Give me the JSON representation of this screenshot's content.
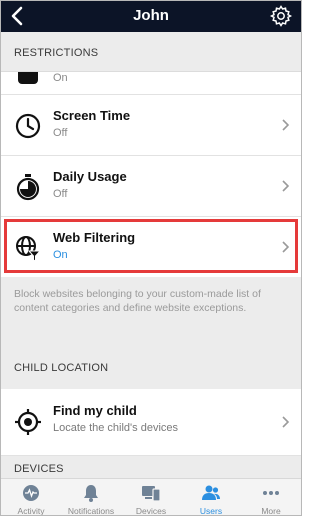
{
  "header": {
    "title": "John"
  },
  "sections": {
    "restrictions": "RESTRICTIONS",
    "child_location": "CHILD LOCATION",
    "devices": "DEVICES"
  },
  "partial_row": {
    "status": "On"
  },
  "rows": [
    {
      "title": "Screen Time",
      "status": "Off",
      "icon": "clock-icon"
    },
    {
      "title": "Daily Usage",
      "status": "Off",
      "icon": "timer-icon"
    },
    {
      "title": "Web Filtering",
      "status": "On",
      "icon": "globe-filter-icon"
    }
  ],
  "web_filter_description": "Block websites belonging to your custom-made list of content categories and define website exceptions.",
  "find_child": {
    "title": "Find my child",
    "subtitle": "Locate the child's devices",
    "icon": "location-target-icon"
  },
  "tabs": [
    {
      "label": "Activity",
      "icon": "activity-icon",
      "active": false
    },
    {
      "label": "Notifications",
      "icon": "bell-icon",
      "active": false
    },
    {
      "label": "Devices",
      "icon": "devices-icon",
      "active": false
    },
    {
      "label": "Users",
      "icon": "users-icon",
      "active": true
    },
    {
      "label": "More",
      "icon": "more-icon",
      "active": false
    }
  ],
  "colors": {
    "header_bg": "#0c1427",
    "accent": "#2b8fe0",
    "highlight": "#e53a3a"
  }
}
